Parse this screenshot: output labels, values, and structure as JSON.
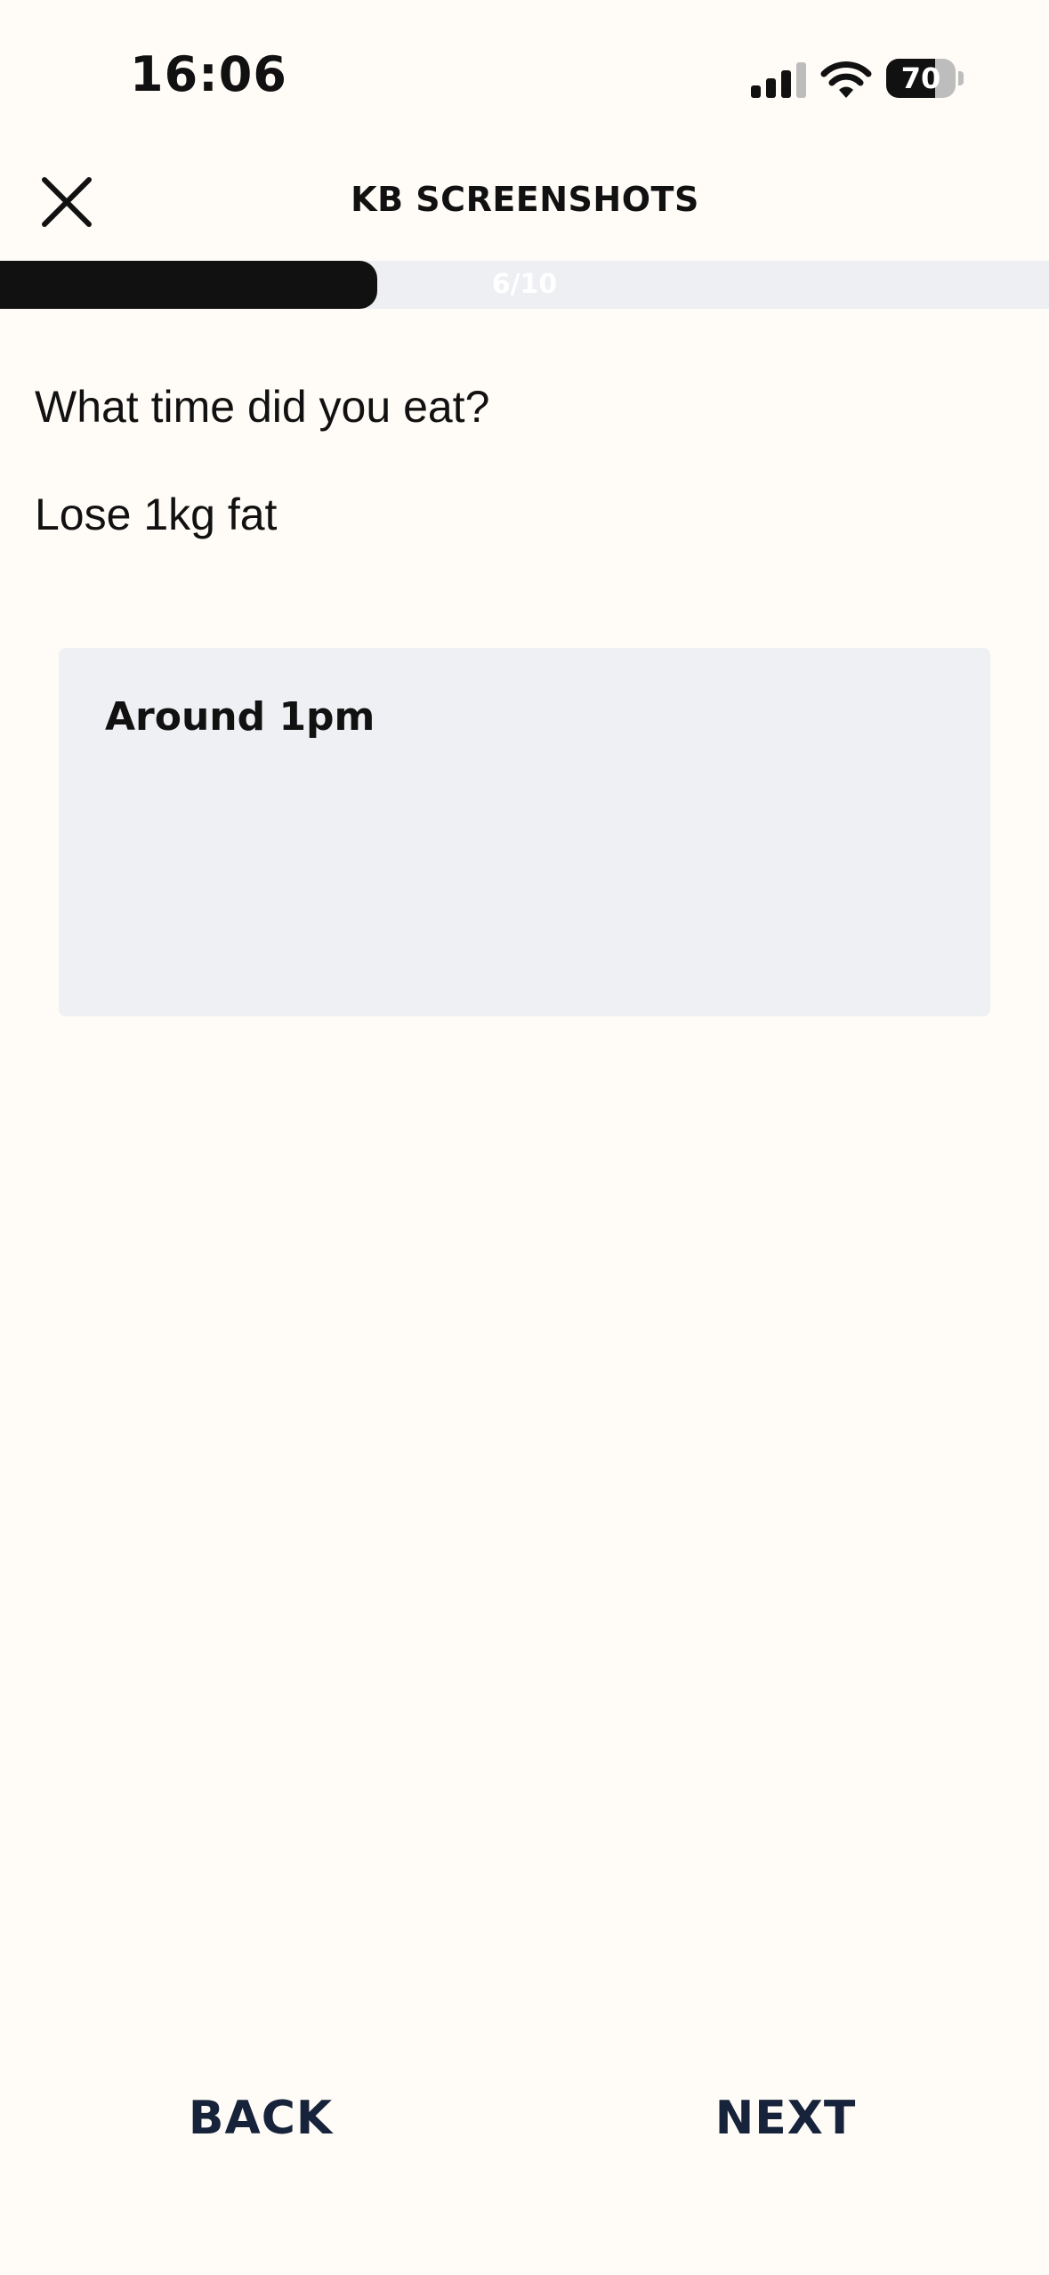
{
  "status_bar": {
    "time": "16:06",
    "battery_level": "70",
    "battery_fraction": 0.7,
    "icons": [
      "signal-icon",
      "wifi-icon",
      "battery-icon"
    ]
  },
  "header": {
    "title": "KB SCREENSHOTS",
    "close_icon": "close-icon"
  },
  "progress": {
    "label": "6/10",
    "current": 6,
    "total": 10
  },
  "question": {
    "text": "What time did you eat?",
    "goal": "Lose 1kg fat"
  },
  "answer": {
    "value": "Around 1pm"
  },
  "footer": {
    "back_label": "BACK",
    "next_label": "NEXT"
  },
  "colors": {
    "background": "#FFFCF7",
    "progress_fill": "#111111",
    "progress_track": "#EEEFF3",
    "answer_box": "#EFF0F3",
    "nav_text": "#16233A"
  }
}
